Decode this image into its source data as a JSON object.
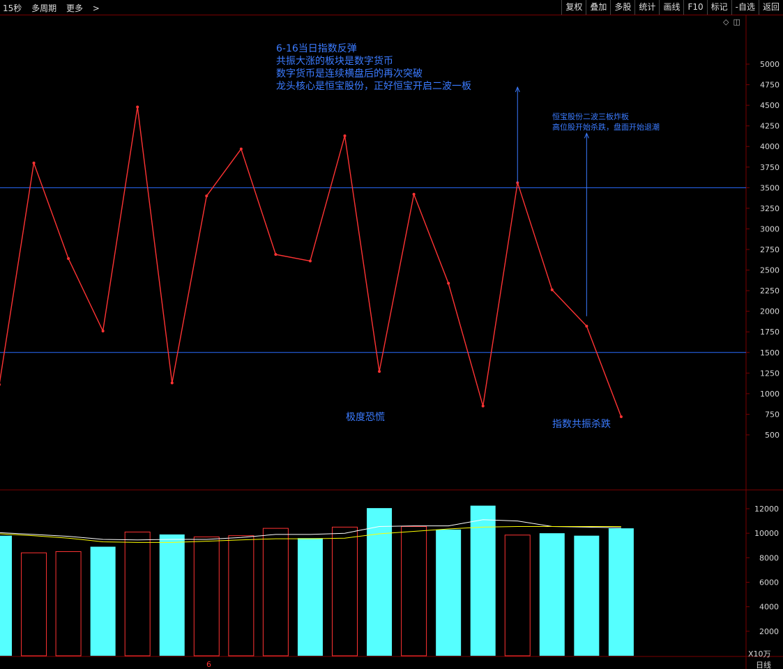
{
  "toolbar": {
    "interval": "15秒",
    "multi_period": "多周期",
    "more": "更多",
    "buttons": [
      "复权",
      "叠加",
      "多股",
      "统计",
      "画线",
      "F10",
      "标记",
      "-自选",
      "返回"
    ]
  },
  "corner_icons": [
    "diamond-icon",
    "panel-toggle-icon"
  ],
  "annotations": {
    "top_note": [
      "6-16当日指数反弹",
      "共振大涨的板块是数字货币",
      "数字货币是连续横盘后的再次突破",
      "龙头核心是恒宝股份，正好恒宝开启二波一板"
    ],
    "right_note": [
      "恒宝股份二波三板炸板",
      "高位股开始杀跌，盘面开始退潮"
    ],
    "panic": "极度恐慌",
    "index_drop": "指数共振杀跌"
  },
  "footer": {
    "date_marker": "6",
    "period_label": "日线",
    "volume_unit": "X10万"
  },
  "colors": {
    "price_line": "#ff3333",
    "annotation": "#3b7bff",
    "hline": "#2a6cff",
    "bar_up": "#ff3333",
    "bar_down": "#55ffff",
    "ma_white": "#ffffff",
    "ma_yellow": "#ffff00",
    "border": "#7a0000"
  },
  "chart_data": [
    {
      "type": "line",
      "x": [
        0,
        1,
        2,
        3,
        4,
        5,
        6,
        7,
        8,
        9,
        10,
        11,
        12,
        13,
        14,
        15,
        16,
        17,
        18
      ],
      "values": [
        1110,
        3800,
        2640,
        1760,
        4480,
        1130,
        3400,
        3970,
        2690,
        2610,
        4130,
        1270,
        3420,
        2340,
        850,
        3560,
        2260,
        1820,
        720
      ],
      "ylim": [
        350,
        5400
      ],
      "yticks": [
        5000,
        4750,
        4500,
        4250,
        4000,
        3750,
        3500,
        3250,
        3000,
        2750,
        2500,
        2250,
        2000,
        1750,
        1500,
        1250,
        1000,
        750.0,
        500.0
      ],
      "hlines": [
        3500,
        1500
      ],
      "arrows": [
        {
          "x": 15,
          "from": 3560,
          "to": 4720
        },
        {
          "x": 17,
          "from": 1940,
          "to": 4160
        }
      ]
    },
    {
      "type": "bar",
      "x": [
        0,
        1,
        2,
        3,
        4,
        5,
        6,
        7,
        8,
        9,
        10,
        11,
        12,
        13,
        14,
        15,
        16,
        17,
        18
      ],
      "values": [
        9800,
        8400,
        8500,
        8900,
        10100,
        9900,
        9700,
        9800,
        10400,
        9600,
        10500,
        12050,
        10550,
        10300,
        12250,
        9850,
        10000,
        9800,
        10400
      ],
      "colors": [
        "down",
        "up",
        "up",
        "down",
        "up",
        "down",
        "up",
        "up",
        "up",
        "down",
        "up",
        "down",
        "up",
        "down",
        "down",
        "up",
        "down",
        "down",
        "down"
      ],
      "ylim": [
        0,
        13200
      ],
      "yticks": [
        12000,
        10000,
        8000,
        6000,
        4000,
        2000
      ],
      "ma_white": [
        10050,
        9900,
        9750,
        9500,
        9450,
        9500,
        9500,
        9650,
        9900,
        9900,
        10000,
        10550,
        10600,
        10600,
        11100,
        11000,
        10550,
        10500,
        10450
      ],
      "ma_yellow": [
        9950,
        9800,
        9600,
        9300,
        9250,
        9250,
        9350,
        9450,
        9550,
        9550,
        9600,
        9950,
        10150,
        10350,
        10500,
        10550,
        10550,
        10550,
        10550
      ]
    }
  ]
}
